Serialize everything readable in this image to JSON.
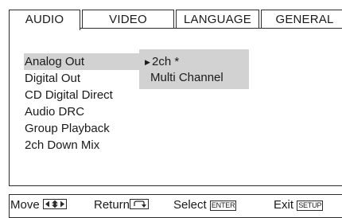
{
  "tabs": [
    {
      "label": "AUDIO",
      "active": true
    },
    {
      "label": "VIDEO",
      "active": false
    },
    {
      "label": "LANGUAGE",
      "active": false
    },
    {
      "label": "GENERAL",
      "active": false
    }
  ],
  "menu": {
    "items": [
      {
        "label": "Analog Out",
        "selected": true
      },
      {
        "label": "Digital Out",
        "selected": false
      },
      {
        "label": "CD Digital Direct",
        "selected": false
      },
      {
        "label": "Audio DRC",
        "selected": false
      },
      {
        "label": "Group Playback",
        "selected": false
      },
      {
        "label": "2ch Down Mix",
        "selected": false
      }
    ]
  },
  "submenu": {
    "items": [
      {
        "label": "2ch *",
        "current": true
      },
      {
        "label": "Multi Channel",
        "current": false
      }
    ],
    "pointer_icon": "right-triangle-icon"
  },
  "footer": {
    "move_label": "Move",
    "move_icon": "four-way-arrow-icon",
    "return_label": "Return",
    "return_icon": "return-arrow-icon",
    "select_label": "Select",
    "select_key": "ENTER",
    "exit_label": "Exit",
    "exit_key": "SETUP"
  },
  "colors": {
    "highlight": "#d2d2d2",
    "border": "#2b2b2b",
    "text": "#1a1a1a",
    "background": "#ffffff"
  }
}
